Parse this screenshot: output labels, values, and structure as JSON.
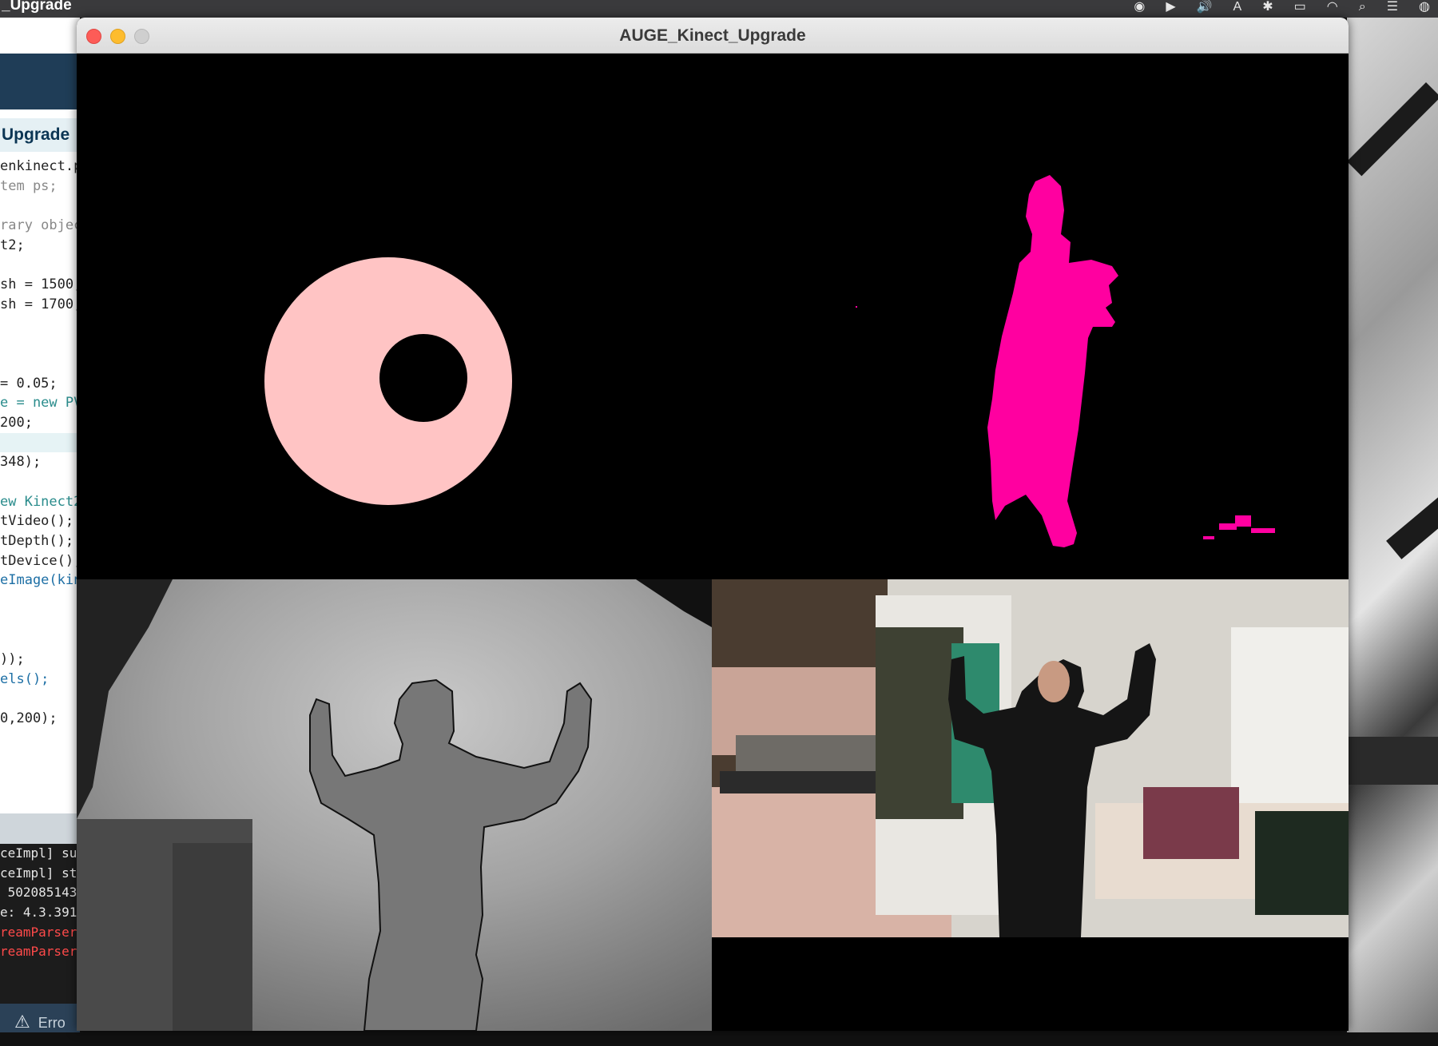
{
  "menubar": {
    "app_title": "_Upgrade",
    "tray_icons": [
      "screen-record-icon",
      "play-icon",
      "volume-icon",
      "input-source-icon",
      "bluetooth-icon",
      "battery-icon",
      "wifi-icon",
      "spotlight-icon",
      "control-center-icon",
      "siri-icon"
    ],
    "input_source_letter": "A"
  },
  "ide": {
    "tab_label": "Upgrade",
    "code_lines": [
      {
        "text": "enkinect.p",
        "type": "normal"
      },
      {
        "text": "tem ps;",
        "type": "comment"
      },
      {
        "text": "",
        "type": "normal"
      },
      {
        "text": "rary objec",
        "type": "comment"
      },
      {
        "text": "t2;",
        "type": "normal"
      },
      {
        "text": "",
        "type": "normal"
      },
      {
        "text": "sh = 1500;",
        "type": "normal"
      },
      {
        "text": "sh = 1700;",
        "type": "normal"
      },
      {
        "text": "",
        "type": "normal"
      },
      {
        "text": "",
        "type": "normal"
      },
      {
        "text": "",
        "type": "normal"
      },
      {
        "text": "= 0.05;",
        "type": "normal"
      },
      {
        "text": "e = new PV",
        "type": "keyword"
      },
      {
        "text": "200;",
        "type": "normal"
      },
      {
        "text": "",
        "type": "highlight"
      },
      {
        "text": "348);",
        "type": "normal"
      },
      {
        "text": "",
        "type": "normal"
      },
      {
        "text": "ew Kinect2",
        "type": "keyword"
      },
      {
        "text": "tVideo();",
        "type": "normal"
      },
      {
        "text": "tDepth();",
        "type": "normal"
      },
      {
        "text": "tDevice();",
        "type": "normal"
      },
      {
        "text": "eImage(kin",
        "type": "function"
      },
      {
        "text": "",
        "type": "normal"
      },
      {
        "text": "",
        "type": "normal"
      },
      {
        "text": "",
        "type": "normal"
      },
      {
        "text": "));",
        "type": "normal"
      },
      {
        "text": "els();",
        "type": "function"
      },
      {
        "text": "",
        "type": "normal"
      },
      {
        "text": "0,200);",
        "type": "normal"
      }
    ],
    "console_lines": [
      {
        "text": "ceImpl] su",
        "type": "normal"
      },
      {
        "text": "ceImpl] st",
        "type": "normal"
      },
      {
        "text": " 502085143",
        "type": "normal"
      },
      {
        "text": "e: 4.3.391",
        "type": "normal"
      },
      {
        "text": "reamParser",
        "type": "error"
      },
      {
        "text": "reamParser",
        "type": "error"
      }
    ],
    "error_label": "Erro"
  },
  "window": {
    "title": "AUGE_Kinect_Upgrade"
  },
  "colors": {
    "ring": "#ffc4c4",
    "silhouette": "#ff00a0",
    "canvas_bg": "#000000"
  }
}
